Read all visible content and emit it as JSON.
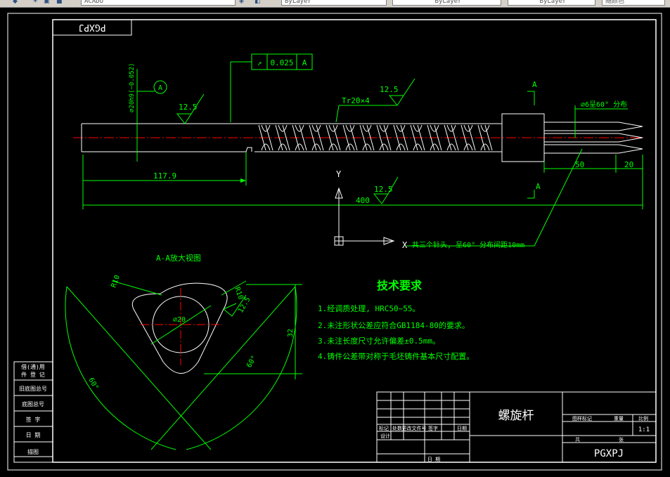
{
  "toolbar": {
    "textstyle_value": "ACADU",
    "layer_color": "ByLayer",
    "layer_linetype": "ByLayer",
    "layer_lineweight": "ByLayer",
    "plotstyle": "随颜色"
  },
  "drawing": {
    "part_code_mirrored": "PGXPJ",
    "tolerance_symbol": "↗",
    "tolerance_value": "0.025",
    "tolerance_datum": "A",
    "datum_label": "A",
    "diameter_dim": "⌀20h9(−0.052)",
    "roughness_1": "12.5",
    "roughness_2": "12.5",
    "roughness_3": "12.5",
    "roughness_4": "12.5",
    "thread_label": "Tr20×4",
    "section_mark_top": "A",
    "section_mark_bottom": "A",
    "pin_note": "⌀6呈60° 分布",
    "dim_117": "117.9",
    "dim_400": "400",
    "dim_50": "50",
    "dim_20": "20",
    "ucs_y": "Y",
    "ucs_x": "X",
    "leader_note": "共三个针头, 呈60° 分布间距10mm",
    "section_title": "A-A放大视图",
    "sec_dim_r10a": "R10",
    "sec_dim_r10b": "R10",
    "sec_dim_d20": "⌀20",
    "sec_dim_32": "32",
    "sec_dim_60a": "60°",
    "sec_dim_60b": "60°",
    "sec_roughness": "12.5"
  },
  "tech_requirements": {
    "title": "技术要求",
    "items": [
      "1.经调质处理, HRC50~55。",
      "2.未注形状公差应符合GB1184-80的要求。",
      "3.未注长度尺寸允许偏差±0.5mm。",
      "4.铸件公差带对称于毛坯铸件基本尺寸配置。"
    ]
  },
  "left_strip": {
    "cells": [
      "借(通)用",
      "件 登 记",
      "旧底图总号",
      "底图总号",
      "签 字",
      "日 期",
      "描图"
    ]
  },
  "title_block": {
    "part_name": "螺旋杆",
    "drawing_no": "PGXPJ",
    "scale": "1:1",
    "change_headers": [
      "标记",
      "处数",
      "更改文件号",
      "签字",
      "日期"
    ],
    "design_label": "设计",
    "date_label": "日期",
    "approve_label": "日 期",
    "stage_mark": "图样标记",
    "weight": "重量",
    "scale_label": "比例",
    "sheet_total": "共",
    "sheet": "张"
  },
  "colors": {
    "background": "#000000",
    "geometry": "#ffffff",
    "dimension": "#00ff00",
    "centerline": "#ff0000",
    "toolbar": "#d4d0c8"
  }
}
